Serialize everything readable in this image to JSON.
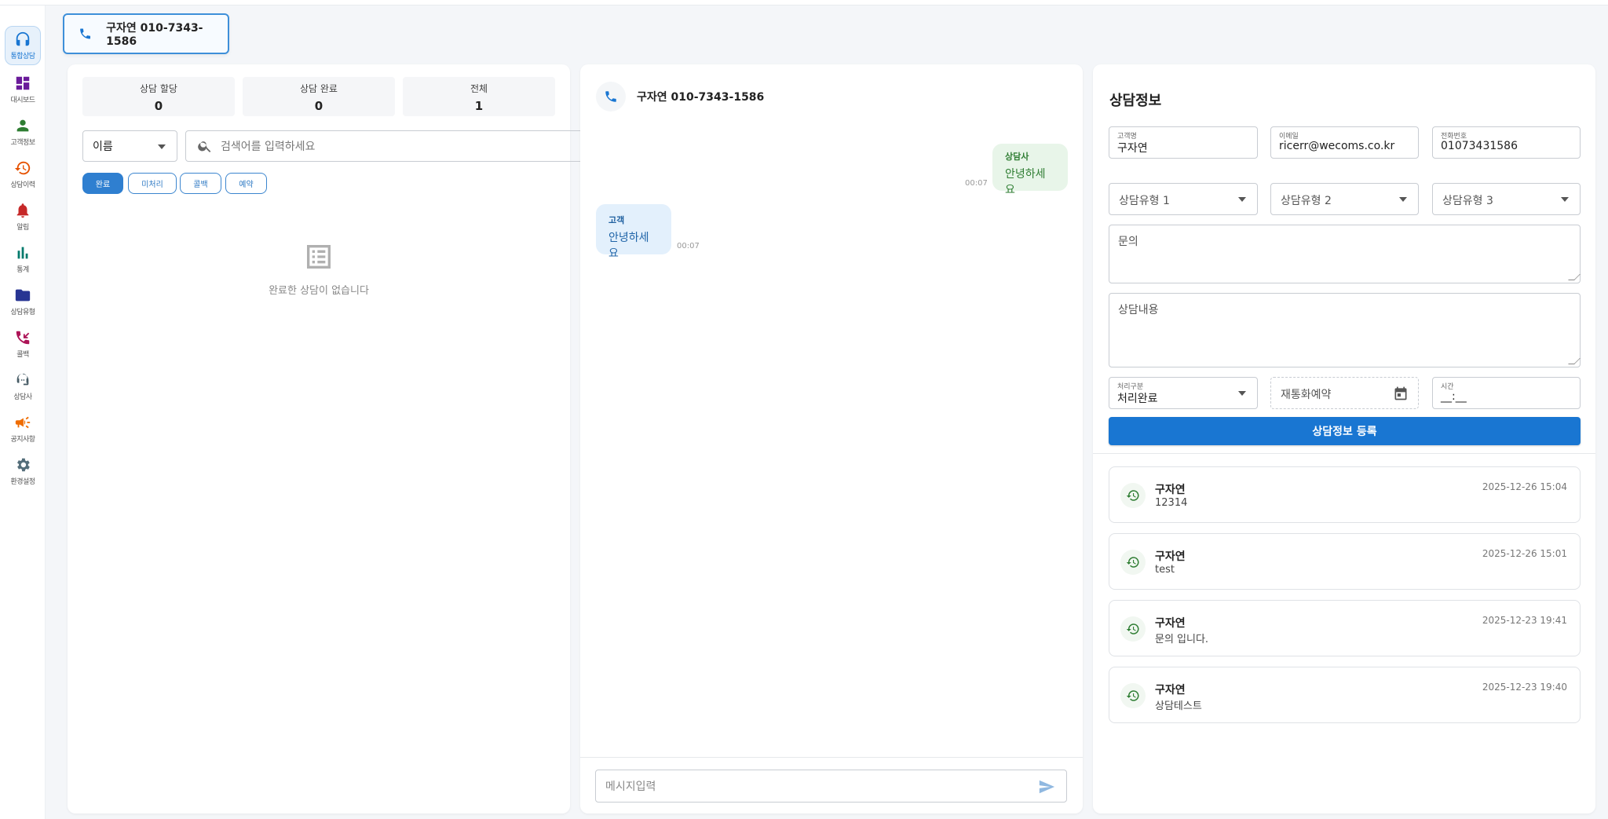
{
  "nav": {
    "items": [
      {
        "label": "통합상담",
        "icon": "headset-icon"
      },
      {
        "label": "대시보드",
        "icon": "dashboard-icon"
      },
      {
        "label": "고객정보",
        "icon": "person-icon"
      },
      {
        "label": "상담이력",
        "icon": "history-icon"
      },
      {
        "label": "알림",
        "icon": "bell-icon"
      },
      {
        "label": "통계",
        "icon": "bar-chart-icon"
      },
      {
        "label": "상담유형",
        "icon": "folder-icon"
      },
      {
        "label": "콜백",
        "icon": "callback-icon"
      },
      {
        "label": "상담사",
        "icon": "support-agent-icon"
      },
      {
        "label": "공지사항",
        "icon": "megaphone-icon"
      },
      {
        "label": "환경설정",
        "icon": "gear-icon"
      }
    ]
  },
  "call_tab": {
    "label": "구자연 010-7343-1586"
  },
  "left": {
    "stats": [
      {
        "label": "상담 할당",
        "value": "0"
      },
      {
        "label": "상담 완료",
        "value": "0"
      },
      {
        "label": "전체",
        "value": "1"
      }
    ],
    "filter_select": "이름",
    "search_placeholder": "검색어를 입력하세요",
    "chips": [
      "완료",
      "미처리",
      "콜백",
      "예약"
    ],
    "empty_text": "완료한 상담이 없습니다"
  },
  "chat": {
    "header": "구자연 010-7343-1586",
    "messages": [
      {
        "who": "상담사",
        "text": "안녕하세요",
        "time": "00:07"
      },
      {
        "who": "고객",
        "text": "안녕하세요",
        "time": "00:07"
      }
    ],
    "input_placeholder": "메시지입력"
  },
  "form": {
    "title": "상담정보",
    "customer_name_label": "고객명",
    "customer_name": "구자연",
    "email_label": "이메일",
    "email": "ricerr@wecoms.co.kr",
    "phone_label": "전화번호",
    "phone": "01073431586",
    "type1": "상담유형 1",
    "type2": "상담유형 2",
    "type3": "상담유형 3",
    "inquiry_placeholder": "문의",
    "content_placeholder": "상담내용",
    "status_label": "처리구분",
    "status_value": "처리완료",
    "recall_placeholder": "재통화예약",
    "time_label": "시간",
    "time_value": "__:__",
    "submit_label": "상담정보 등록"
  },
  "history": [
    {
      "name": "구자연",
      "content": "12314",
      "date": "2025-12-26 15:04"
    },
    {
      "name": "구자연",
      "content": "test",
      "date": "2025-12-26 15:01"
    },
    {
      "name": "구자연",
      "content": "문의 입니다.",
      "date": "2025-12-23 19:41"
    },
    {
      "name": "구자연",
      "content": "상담테스트",
      "date": "2025-12-23 19:40"
    }
  ],
  "colors": {
    "accent": "#1976d2",
    "agent_bubble": "#e8f5e9",
    "customer_bubble": "#e3f0fc"
  }
}
